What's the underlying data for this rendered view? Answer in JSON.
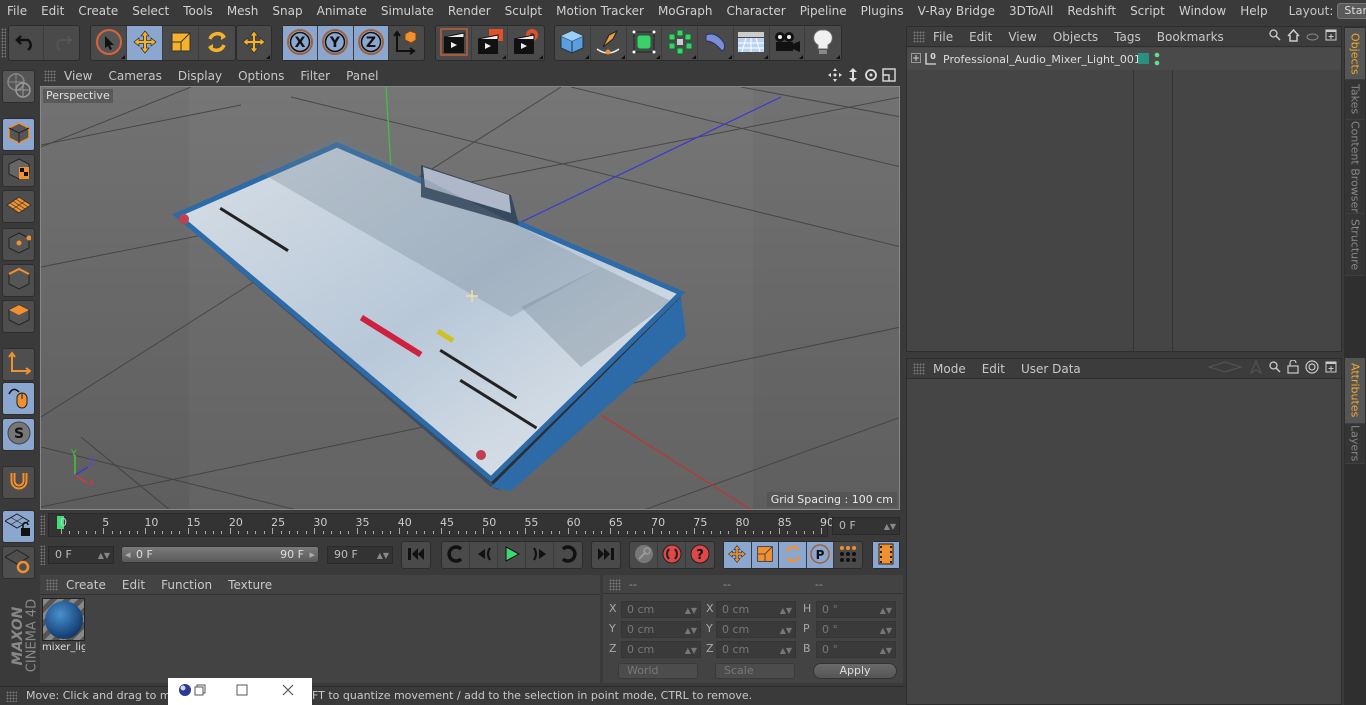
{
  "menubar": {
    "items": [
      "File",
      "Edit",
      "Create",
      "Select",
      "Tools",
      "Mesh",
      "Snap",
      "Animate",
      "Simulate",
      "Render",
      "Sculpt",
      "Motion Tracker",
      "MoGraph",
      "Character",
      "Pipeline",
      "Plugins",
      "V-Ray Bridge",
      "3DToAll",
      "Redshift",
      "Script",
      "Window",
      "Help"
    ],
    "layout_label": "Layout:",
    "layout_value": "Startup"
  },
  "toolbar": {
    "groups": [
      {
        "name": "history",
        "buttons": [
          "undo-icon",
          "redo-icon"
        ]
      },
      {
        "name": "tools",
        "buttons": [
          "live-selection-icon",
          "move-icon",
          "scale-icon",
          "rotate-icon"
        ]
      },
      {
        "name": "last-tool",
        "buttons": [
          "recent-tool-icon"
        ]
      },
      {
        "name": "axis",
        "buttons": [
          "x-axis-lock-icon",
          "y-axis-lock-icon",
          "z-axis-lock-icon",
          "coordinate-system-icon"
        ]
      },
      {
        "name": "render",
        "buttons": [
          "render-view-icon",
          "render-picture-viewer-icon",
          "render-settings-icon"
        ]
      },
      {
        "name": "objects",
        "buttons": [
          "cube-icon",
          "pen-spline-icon",
          "subdivision-icon",
          "cloner-icon",
          "deformer-icon",
          "floor-icon",
          "camera-icon",
          "light-icon"
        ]
      }
    ]
  },
  "left_tools": [
    "make-editable-icon",
    "model-mode-icon",
    "texture-mode-icon",
    "workplane-icon",
    "points-mode-icon",
    "edges-mode-icon",
    "polygons-mode-icon",
    "axis-mode-icon",
    "tweak-mode-icon",
    "solo-icon",
    "snap-magnet-icon",
    "workplane-lock-icon",
    "workplane-rotate-icon"
  ],
  "viewport": {
    "menu": [
      "View",
      "Cameras",
      "Display",
      "Options",
      "Filter",
      "Panel"
    ],
    "label": "Perspective",
    "grid_spacing": "Grid Spacing : 100 cm",
    "axis_labels": {
      "x": "X",
      "y": "Y",
      "z": "Z"
    },
    "colors": {
      "x": "#d23a3a",
      "y": "#3ac83a",
      "z": "#3a3ad2"
    }
  },
  "timeline": {
    "ticks": [
      "0",
      "5",
      "10",
      "15",
      "20",
      "25",
      "30",
      "35",
      "40",
      "45",
      "50",
      "55",
      "60",
      "65",
      "70",
      "75",
      "80",
      "85",
      "90"
    ],
    "current_frame": "0 F",
    "start_field": "0 F",
    "range_start": "0 F",
    "range_end": "90 F",
    "end_field": "90 F",
    "frame_display": "0 F",
    "playhead_fraction": 0.0
  },
  "materials": {
    "menu": [
      "Create",
      "Edit",
      "Function",
      "Texture"
    ],
    "items": [
      {
        "label": "mixer_lig"
      }
    ]
  },
  "coordinates": {
    "headers": [
      "--",
      "--",
      "--"
    ],
    "rows": [
      {
        "l1": "X",
        "v1": "0 cm",
        "l2": "X",
        "v2": "0 cm",
        "l3": "H",
        "v3": "0 °"
      },
      {
        "l1": "Y",
        "v1": "0 cm",
        "l2": "Y",
        "v2": "0 cm",
        "l3": "P",
        "v3": "0 °"
      },
      {
        "l1": "Z",
        "v1": "0 cm",
        "l2": "Z",
        "v2": "0 cm",
        "l3": "B",
        "v3": "0 °"
      }
    ],
    "mode_select": "World",
    "type_select": "Scale",
    "apply": "Apply"
  },
  "status": {
    "text_left": "Move: Click and drag to mo",
    "text_right": "FT to quantize movement / add to the selection in point mode, CTRL to remove."
  },
  "objects_panel": {
    "menu": [
      "File",
      "Edit",
      "View",
      "Objects",
      "Tags",
      "Bookmarks"
    ],
    "items": [
      {
        "name": "Professional_Audio_Mixer_Light_001",
        "layer_color": "#2a9080",
        "dot_color": "#5fe08a"
      }
    ]
  },
  "attributes_panel": {
    "menu": [
      "Mode",
      "Edit",
      "User Data"
    ]
  },
  "side_tabs_top": [
    {
      "label": "Objects",
      "active": true
    },
    {
      "label": "Takes",
      "active": false
    },
    {
      "label": "Content Browser",
      "active": false
    },
    {
      "label": "Structure",
      "active": false
    }
  ],
  "side_tabs_bottom": [
    {
      "label": "Attributes",
      "active": true
    },
    {
      "label": "Layers",
      "active": false
    }
  ],
  "branding": {
    "line1": "MAXON",
    "line2": "CINEMA 4D"
  },
  "accent": "#8ba6cf",
  "highlight": "#f0a830"
}
